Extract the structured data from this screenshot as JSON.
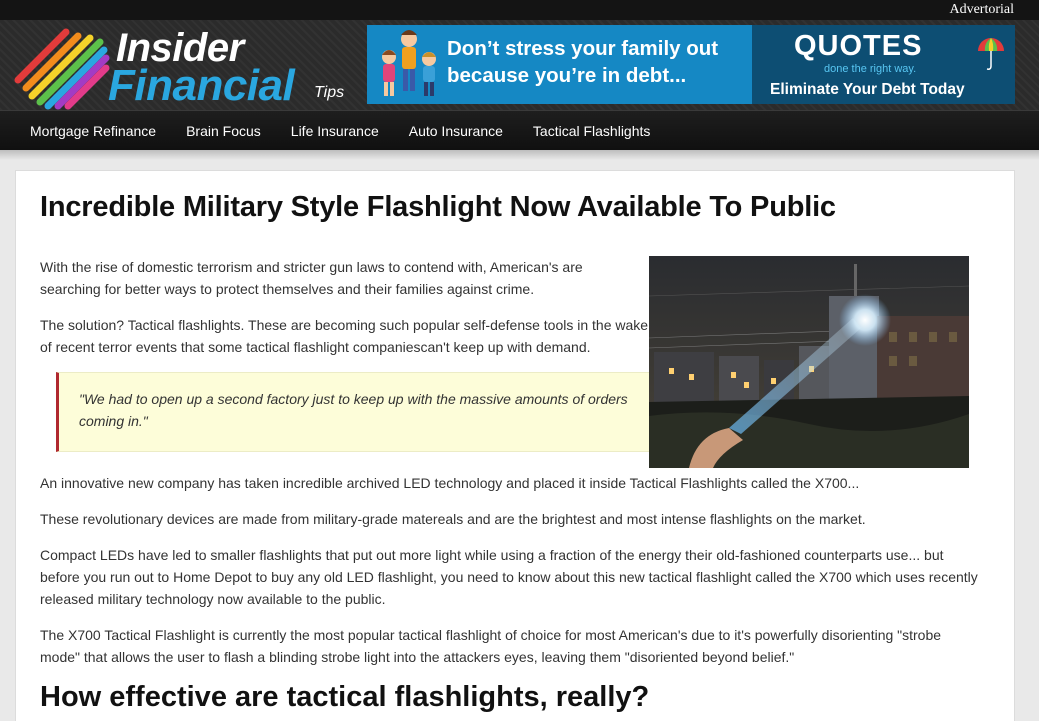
{
  "topbar": {
    "advertorial": "Advertorial"
  },
  "logo": {
    "line1": "Insider",
    "line2": "Financial",
    "line3": "Tips"
  },
  "banner": {
    "message": "Don’t stress your family out because you’re in debt...",
    "brand": "QUOTES",
    "tagline": "done the right way.",
    "cta": "Eliminate Your Debt Today"
  },
  "nav": {
    "items": [
      {
        "label": "Mortgage Refinance"
      },
      {
        "label": "Brain Focus"
      },
      {
        "label": "Life Insurance"
      },
      {
        "label": "Auto Insurance"
      },
      {
        "label": "Tactical Flashlights"
      }
    ]
  },
  "article": {
    "title": "Incredible Military Style Flashlight Now Available To Public",
    "p1": "With the rise of domestic terrorism and stricter gun laws to contend with, American's are searching for better ways to protect themselves and their families against crime.",
    "p2": "The solution? Tactical flashlights. These are becoming such popular self-defense tools in the wake of recent terror events that some tactical flashlight companiescan't keep up with demand.",
    "quote": "\"We had to open up a second factory just to keep up with the massive amounts of orders coming in.\"",
    "p3": "An innovative new company has taken incredible archived LED technology and placed it inside Tactical Flashlights called the X700...",
    "p4": "These revolutionary devices are made from military-grade matereals and are the brightest and most intense flashlights on the market.",
    "p5": "Compact LEDs have led to smaller flashlights that put out more light while using a fraction of the energy their old-fashioned counterparts use... but before you run out to Home Depot to buy any old LED flashlight, you need to know about this new tactical flashlight called the X700 which uses recently released military technology now available to the public.",
    "p6": "The X700 Tactical Flashlight is currently the most popular tactical flashlight of choice for most American's due to it's powerfully disorienting \"strobe mode\" that allows the user to flash a blinding strobe light into the attackers eyes, leaving them \"disoriented beyond belief.\"",
    "h2": "How effective are tactical flashlights, really?"
  },
  "colors": {
    "accent_blue": "#2aa7e0",
    "banner_blue": "#1588c4",
    "quote_border": "#b0282f",
    "quote_bg": "#fdfdd9"
  }
}
